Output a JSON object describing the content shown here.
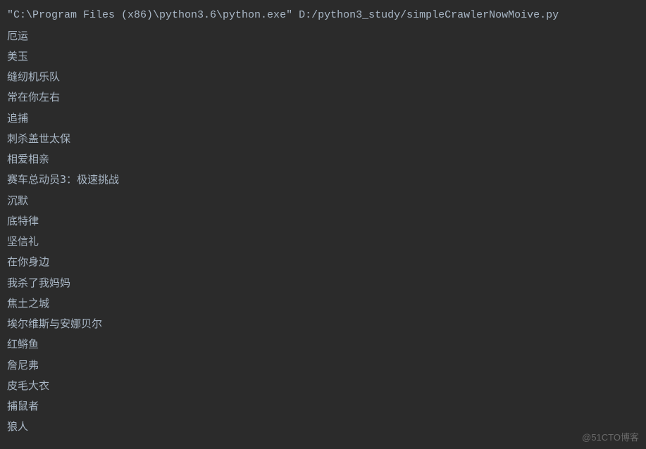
{
  "console": {
    "command": "\"C:\\Program Files (x86)\\python3.6\\python.exe\" D:/python3_study/simpleCrawlerNowMoive.py",
    "output": [
      "厄运",
      "美玉",
      "缝纫机乐队",
      "常在你左右",
      "追捕",
      "刺杀盖世太保",
      "相爱相亲",
      "赛车总动员3：极速挑战",
      "沉默",
      "底特律",
      "坚信礼",
      "在你身边",
      "我杀了我妈妈",
      "焦土之城",
      "埃尔维斯与安娜贝尔",
      "红鳉鱼",
      "詹尼弗",
      "皮毛大衣",
      "捕鼠者",
      "狼人"
    ]
  },
  "watermark": "@51CTO博客"
}
